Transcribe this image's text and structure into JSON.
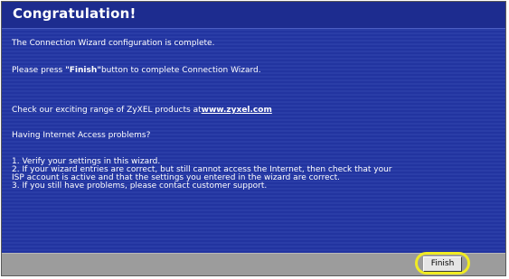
{
  "header": {
    "title": "Congratulation!"
  },
  "messages": {
    "line1": "The Connection Wizard configuration is complete.",
    "line2_prefix": "Please press ",
    "line2_button_ref": "\"Finish\"",
    "line2_suffix": "button to complete Connection Wizard.",
    "line3_prefix": "Check our exciting range of ZyXEL products at",
    "line3_link": "www.zyxel.com",
    "line4": "Having Internet Access problems?",
    "list_items": [
      "1. Verify your settings in this wizard.",
      "2. If your wizard entries are correct, but still cannot access the Internet, then check that your",
      "ISP account is active and that the settings you entered in the wizard are correct.",
      "3. If you still have problems, please contact customer support."
    ]
  },
  "footer": {
    "finish_label": "Finish"
  },
  "colors": {
    "header_blue": "#1d2c8f",
    "content_blue": "#22339c",
    "footer_gray": "#9c9c9c",
    "highlight_yellow": "#f0eb23"
  }
}
